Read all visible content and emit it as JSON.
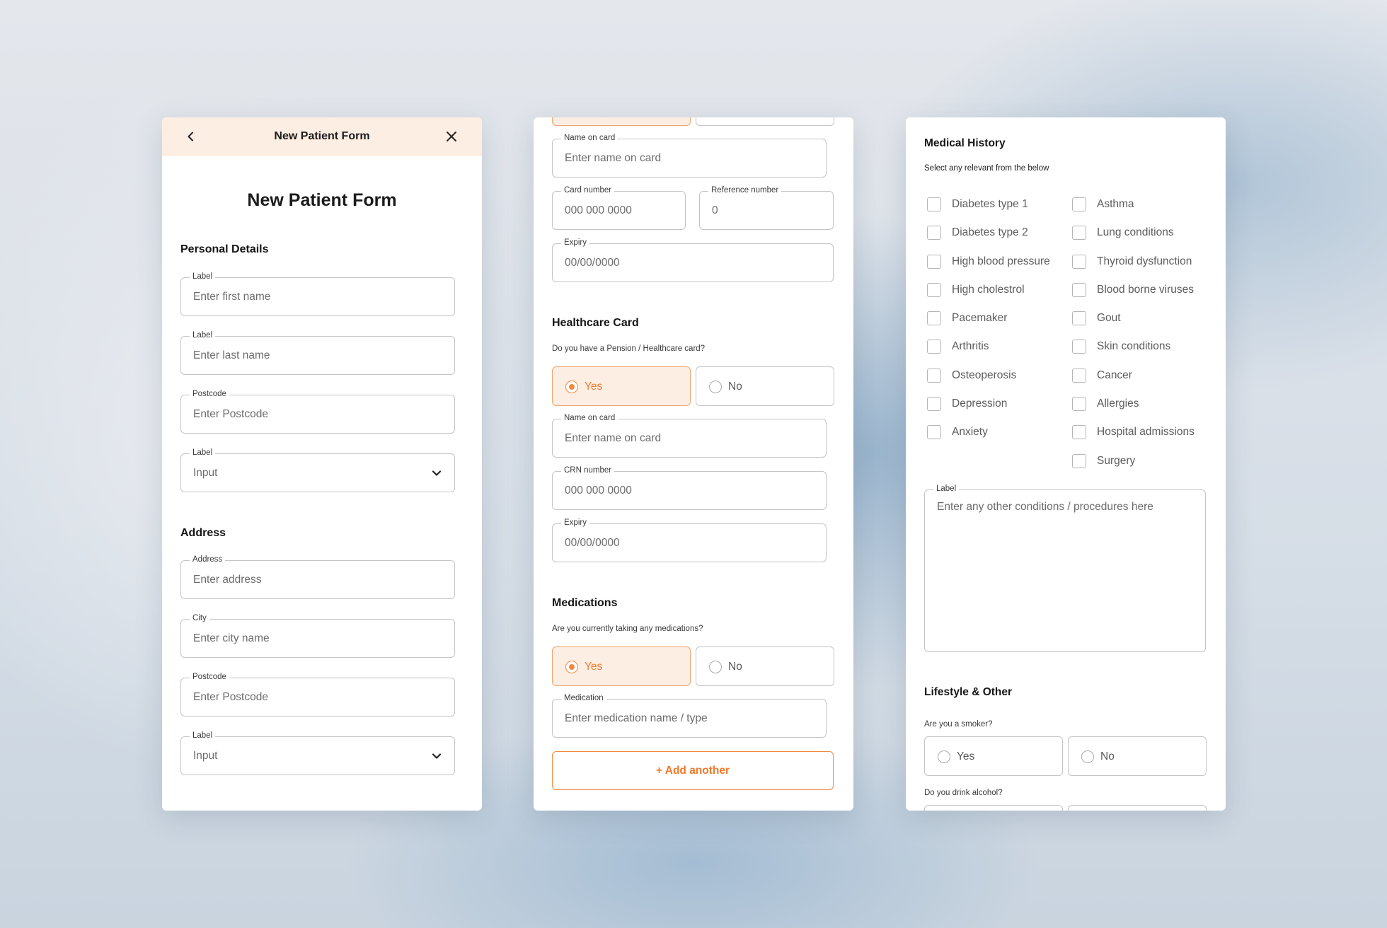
{
  "panel1": {
    "topbar_title": "New Patient Form",
    "heading": "New Patient Form",
    "personal_title": "Personal Details",
    "personal_fields": [
      {
        "label": "Label",
        "placeholder": "Enter first name"
      },
      {
        "label": "Label",
        "placeholder": "Enter last name"
      },
      {
        "label": "Postcode",
        "placeholder": "Enter Postcode"
      },
      {
        "label": "Label",
        "placeholder": "Input",
        "select": true
      }
    ],
    "address_title": "Address",
    "address_fields": [
      {
        "label": "Address",
        "placeholder": "Enter address"
      },
      {
        "label": "City",
        "placeholder": "Enter city name"
      },
      {
        "label": "Postcode",
        "placeholder": "Enter Postcode"
      },
      {
        "label": "Label",
        "placeholder": "Input",
        "select": true
      }
    ]
  },
  "panel2": {
    "name_on_card_label": "Name on card",
    "name_on_card_placeholder": "Enter name on card",
    "card_number_label": "Card number",
    "card_number_placeholder": "000 000 0000",
    "reference_label": "Reference number",
    "reference_placeholder": "0",
    "expiry_label": "Expiry",
    "expiry_placeholder": "00/00/0000",
    "healthcare": {
      "title": "Healthcare Card",
      "question": "Do you have a Pension / Healthcare card?",
      "yes": "Yes",
      "no": "No",
      "name_label": "Name on card",
      "name_placeholder": "Enter name on card",
      "crn_label": "CRN number",
      "crn_placeholder": "000 000 0000",
      "expiry_label": "Expiry",
      "expiry_placeholder": "00/00/0000"
    },
    "medications": {
      "title": "Medications",
      "question": "Are you currently taking any medications?",
      "yes": "Yes",
      "no": "No",
      "med_label": "Medication",
      "med_placeholder": "Enter medication name / type",
      "add_another": "+ Add another"
    }
  },
  "panel3": {
    "title": "Medical History",
    "subtitle": "Select any relevant from the below",
    "col1": [
      "Diabetes type 1",
      "Diabetes type 2",
      "High blood pressure",
      "High cholestrol",
      "Pacemaker",
      "Arthritis",
      "Osteoperosis",
      "Depression",
      "Anxiety"
    ],
    "col2": [
      "Asthma",
      "Lung conditions",
      "Thyroid dysfunction",
      "Blood borne viruses",
      "Gout",
      "Skin conditions",
      "Cancer",
      "Allergies",
      "Hospital admissions",
      "Surgery"
    ],
    "other_label": "Label",
    "other_placeholder": "Enter any other conditions / procedures here",
    "lifestyle_title": "Lifestyle & Other",
    "smoker_question": "Are you a smoker?",
    "yes": "Yes",
    "no": "No",
    "alcohol_question": "Do you drink alcohol?"
  },
  "colors": {
    "accent": "#f07a2a",
    "accent_bg": "#fdeee3",
    "border": "#c4c4c4"
  }
}
